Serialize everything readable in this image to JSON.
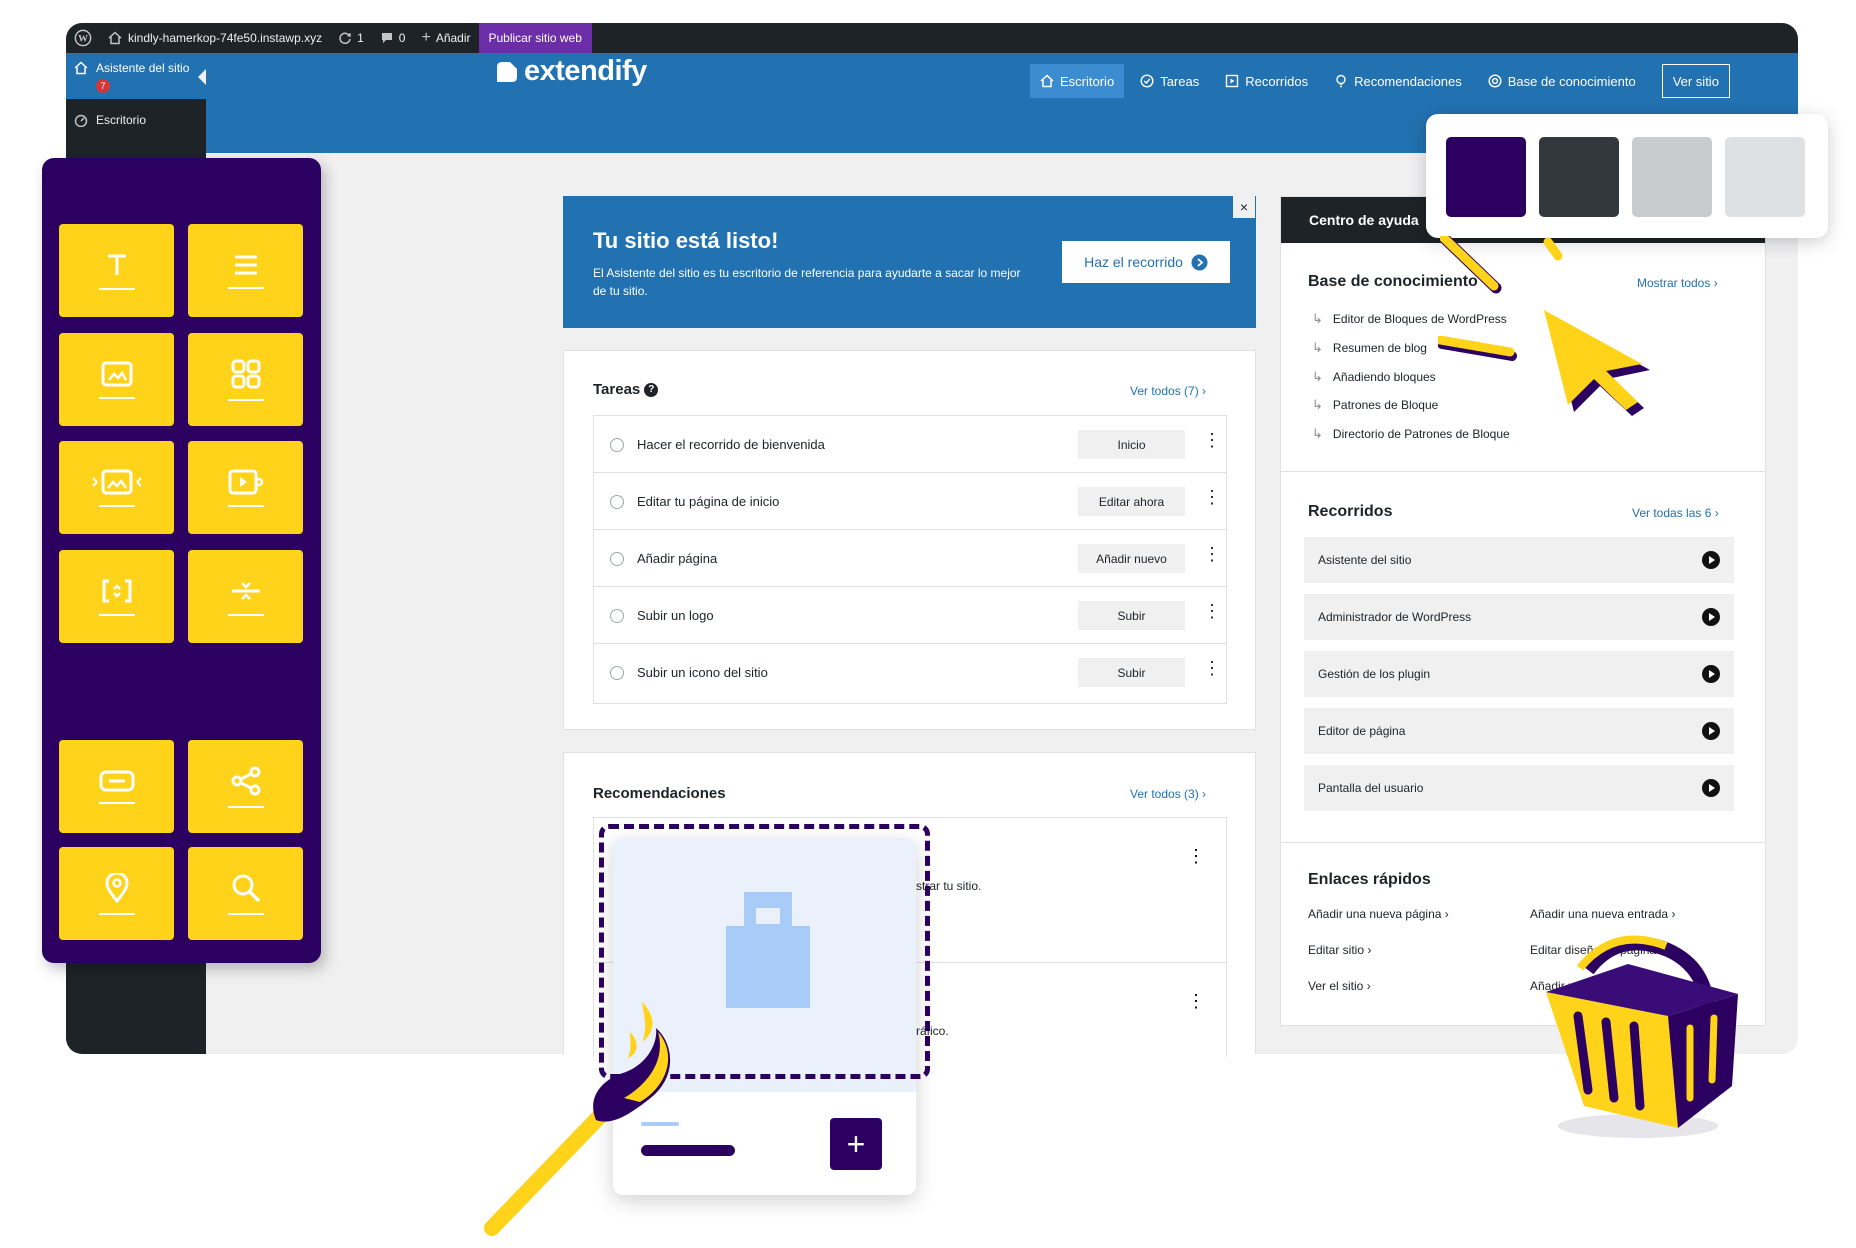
{
  "admin_bar": {
    "site_name": "kindly-hamerkop-74fe50.instawp.xyz",
    "updates_count": "1",
    "comments_count": "0",
    "add_label": "Añadir",
    "publish_label": "Publicar sitio web"
  },
  "wp_sidebar": {
    "items": [
      {
        "label": "Asistente del sitio",
        "badge": "7"
      },
      {
        "label": "Escritorio"
      }
    ]
  },
  "header": {
    "logo_text": "extendify",
    "nav": [
      {
        "label": "Escritorio"
      },
      {
        "label": "Tareas"
      },
      {
        "label": "Recorridos"
      },
      {
        "label": "Recomendaciones"
      },
      {
        "label": "Base de conocimiento"
      }
    ],
    "view_site_label": "Ver sitio"
  },
  "hero": {
    "title": "Tu sitio está listo!",
    "description": "El Asistente del sitio es tu escritorio de referencia para ayudarte a sacar lo mejor de tu sitio.",
    "button_label": "Haz el recorrido",
    "close_label": "×"
  },
  "tasks": {
    "title": "Tareas",
    "help_badge": "?",
    "view_all": "Ver todos (7)",
    "items": [
      {
        "label": "Hacer el recorrido de bienvenida",
        "action": "Inicio"
      },
      {
        "label": "Editar tu página de inicio",
        "action": "Editar ahora"
      },
      {
        "label": "Añadir página",
        "action": "Añadir nuevo"
      },
      {
        "label": "Subir un logo",
        "action": "Subir"
      },
      {
        "label": "Subir un icono del sitio",
        "action": "Subir"
      }
    ]
  },
  "recommendations": {
    "title": "Recomendaciones",
    "view_all": "Ver todos (3)",
    "snippets": [
      "strar tu sitio.",
      "ráfico."
    ]
  },
  "help_center": {
    "tab_label": "Centro de ayuda",
    "knowledge_base": {
      "title": "Base de conocimiento",
      "show_all": "Mostrar todos",
      "items": [
        "Editor de Bloques de WordPress",
        "Resumen de blog",
        "Añadiendo bloques",
        "Patrones de Bloque",
        "Directorio de Patrones de Bloque"
      ]
    },
    "tours": {
      "title": "Recorridos",
      "view_all": "Ver todas las 6",
      "items": [
        "Asistente del sitio",
        "Administrador de WordPress",
        "Gestión de los plugin",
        "Editor de página",
        "Pantalla del usuario"
      ]
    },
    "quick_links": {
      "title": "Enlaces rápidos",
      "items": [
        "Añadir una nueva página",
        "Añadir una nueva entrada",
        "Editar sitio",
        "Editar diseño de página",
        "Ver el sitio",
        "Añadir usuario"
      ]
    }
  },
  "decor": {
    "block_icons": [
      "heading-icon",
      "paragraph-icon",
      "image-icon",
      "gallery-icon",
      "slider-icon",
      "video-icon",
      "cover-icon",
      "separator-icon",
      "button-icon",
      "share-icon",
      "map-pin-icon",
      "search-icon"
    ],
    "swatch_colors": [
      "#2c0060",
      "#33383c",
      "#c9cbcd",
      "#dee1e3"
    ],
    "accent_yellow": "#ffd31a",
    "accent_purple": "#2c0060",
    "wp_blue": "#2271b1"
  }
}
